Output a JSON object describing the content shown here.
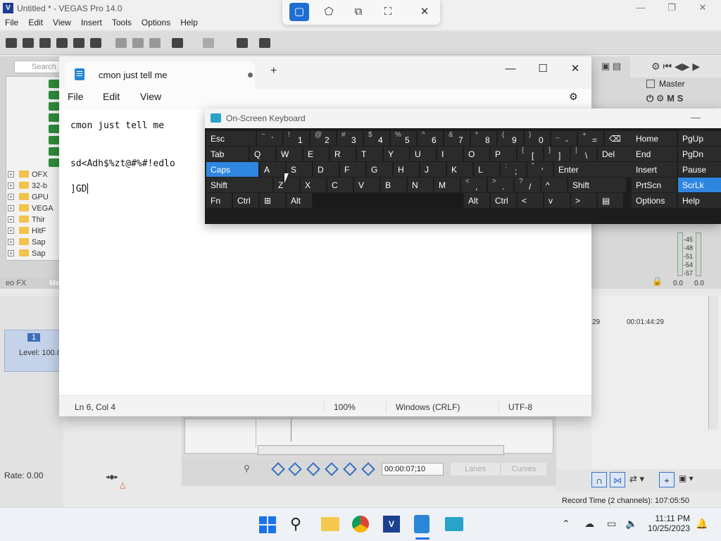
{
  "vegas": {
    "title": "Untitled * - VEGAS Pro 14.0",
    "logo": "V",
    "menu": [
      "File",
      "Edit",
      "View",
      "Insert",
      "Tools",
      "Options",
      "Help"
    ],
    "explorer_search": "Search",
    "explorer_items": [
      "OFX",
      "32-b",
      "GPU",
      "VEGA",
      "Thir",
      "HitF",
      "Sap",
      "Sap"
    ],
    "fx_tab": "eo FX",
    "fx_tab2": "Me",
    "track_number": "1",
    "level": "Level: 100.0",
    "rate": "Rate: 0.00",
    "master": "Master",
    "master_ms": "M S",
    "meter_scale": [
      "-45",
      "-48",
      "-51",
      "-54",
      "-57"
    ],
    "meter_values": [
      "0.0",
      "0.0"
    ],
    "timecode_right": "00:01:44:29",
    "timecode_right_partial": "29",
    "timecode": "00:00:07;10",
    "lanes": "Lanes",
    "curves": "Curves",
    "record_time": "Record Time (2 channels): 107:05:50"
  },
  "snip": {
    "close": "✕"
  },
  "notepad": {
    "tab_title": "cmon just tell me",
    "new_tab": "+",
    "menu": {
      "file": "File",
      "edit": "Edit",
      "view": "View"
    },
    "lines": [
      "cmon just tell me",
      "sd<Adh$%zt@#%#!edlo",
      "]GD"
    ],
    "status": {
      "position": "Ln 6, Col 4",
      "zoom": "100%",
      "eol": "Windows (CRLF)",
      "encoding": "UTF-8"
    }
  },
  "osk": {
    "title": "On-Screen Keyboard",
    "rows": [
      [
        {
          "l": "Esc"
        },
        {
          "u": "~",
          "d": "`"
        },
        {
          "u": "!",
          "d": "1"
        },
        {
          "u": "@",
          "d": "2"
        },
        {
          "u": "#",
          "d": "3"
        },
        {
          "u": "$",
          "d": "4"
        },
        {
          "u": "%",
          "d": "5"
        },
        {
          "u": "^",
          "d": "6"
        },
        {
          "u": "&",
          "d": "7"
        },
        {
          "u": "*",
          "d": "8"
        },
        {
          "u": "(",
          "d": "9"
        },
        {
          "u": ")",
          "d": "0"
        },
        {
          "u": "_",
          "d": "-"
        },
        {
          "u": "+",
          "d": "="
        },
        {
          "l": "⌫"
        }
      ],
      [
        {
          "l": "Tab"
        },
        {
          "l": "Q"
        },
        {
          "l": "W"
        },
        {
          "l": "E"
        },
        {
          "l": "R"
        },
        {
          "l": "T"
        },
        {
          "l": "Y"
        },
        {
          "l": "U"
        },
        {
          "l": "I"
        },
        {
          "l": "O"
        },
        {
          "l": "P"
        },
        {
          "u": "{",
          "d": "["
        },
        {
          "u": "}",
          "d": "]"
        },
        {
          "u": "|",
          "d": "\\"
        },
        {
          "l": "Del"
        }
      ],
      [
        {
          "l": "Caps"
        },
        {
          "l": "A"
        },
        {
          "l": "S"
        },
        {
          "l": "D"
        },
        {
          "l": "F"
        },
        {
          "l": "G"
        },
        {
          "l": "H"
        },
        {
          "l": "J"
        },
        {
          "l": "K"
        },
        {
          "l": "L"
        },
        {
          "u": ":",
          "d": ";"
        },
        {
          "u": "\"",
          "d": "'"
        },
        {
          "l": "Enter"
        }
      ],
      [
        {
          "l": "Shift"
        },
        {
          "l": "Z"
        },
        {
          "l": "X"
        },
        {
          "l": "C"
        },
        {
          "l": "V"
        },
        {
          "l": "B"
        },
        {
          "l": "N"
        },
        {
          "l": "M"
        },
        {
          "u": "<",
          "d": ","
        },
        {
          "u": ">",
          "d": "."
        },
        {
          "u": "?",
          "d": "/"
        },
        {
          "l": "^"
        },
        {
          "l": "Shift"
        }
      ],
      [
        {
          "l": "Fn"
        },
        {
          "l": "Ctrl"
        },
        {
          "l": "⊞"
        },
        {
          "l": "Alt"
        },
        {
          "l": ""
        },
        {
          "l": "Alt"
        },
        {
          "l": "Ctrl"
        },
        {
          "l": "<"
        },
        {
          "l": "v"
        },
        {
          "l": ">"
        },
        {
          "l": "▤"
        }
      ]
    ],
    "nav": [
      [
        "Home",
        "PgUp"
      ],
      [
        "End",
        "PgDn"
      ],
      [
        "Insert",
        "Pause"
      ],
      [
        "PrtScn",
        "ScrLk"
      ],
      [
        "Options",
        "Help"
      ]
    ]
  },
  "taskbar": {
    "time": "11:11 PM",
    "date": "10/25/2023"
  }
}
